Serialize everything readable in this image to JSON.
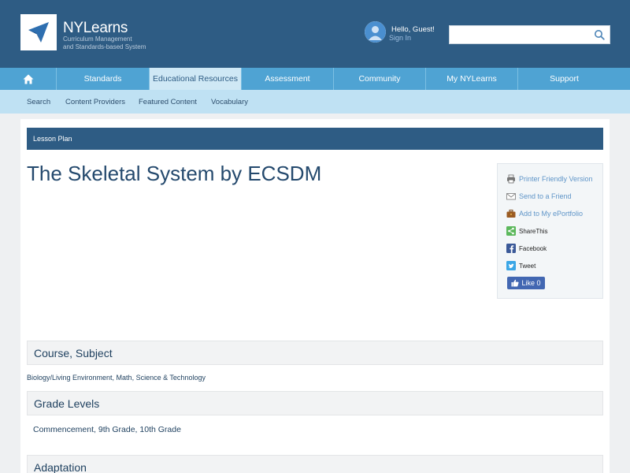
{
  "header": {
    "brand": "NYLearns",
    "tagline_line1": "Curriculum Management",
    "tagline_line2": "and Standards-based System",
    "greeting": "Hello,  Guest!",
    "signin": "Sign In",
    "search_placeholder": "",
    "search_value": ""
  },
  "nav": {
    "home_icon": "home-icon",
    "items": [
      {
        "label": "Standards"
      },
      {
        "label": "Educational Resources",
        "active": true
      },
      {
        "label": "Assessment"
      },
      {
        "label": "Community"
      },
      {
        "label": "My NYLearns"
      },
      {
        "label": "Support"
      }
    ]
  },
  "subnav": {
    "items": [
      "Search",
      "Content Providers",
      "Featured Content",
      "Vocabulary"
    ]
  },
  "content": {
    "section_bar": "Lesson Plan",
    "title": "The Skeletal System by ECSDM"
  },
  "share": {
    "printer": "Printer Friendly Version",
    "send": "Send to a Friend",
    "portfolio": "Add to My ePortfolio",
    "sharethis": "ShareThis",
    "facebook": "Facebook",
    "tweet": "Tweet",
    "like": "Like 0"
  },
  "sections": {
    "course_heading": "Course, Subject",
    "course_value": "Biology/Living Environment, Math, Science & Technology",
    "grade_heading": "Grade Levels",
    "grade_value": "Commencement, 9th Grade, 10th Grade",
    "adaptation_heading": "Adaptation"
  },
  "colors": {
    "header_bg": "#2e5c84",
    "nav_bg": "#4fa3d3",
    "nav_active_bg": "#cfe8f5",
    "subnav_bg": "#bfe1f3",
    "title_color": "#24496d"
  }
}
